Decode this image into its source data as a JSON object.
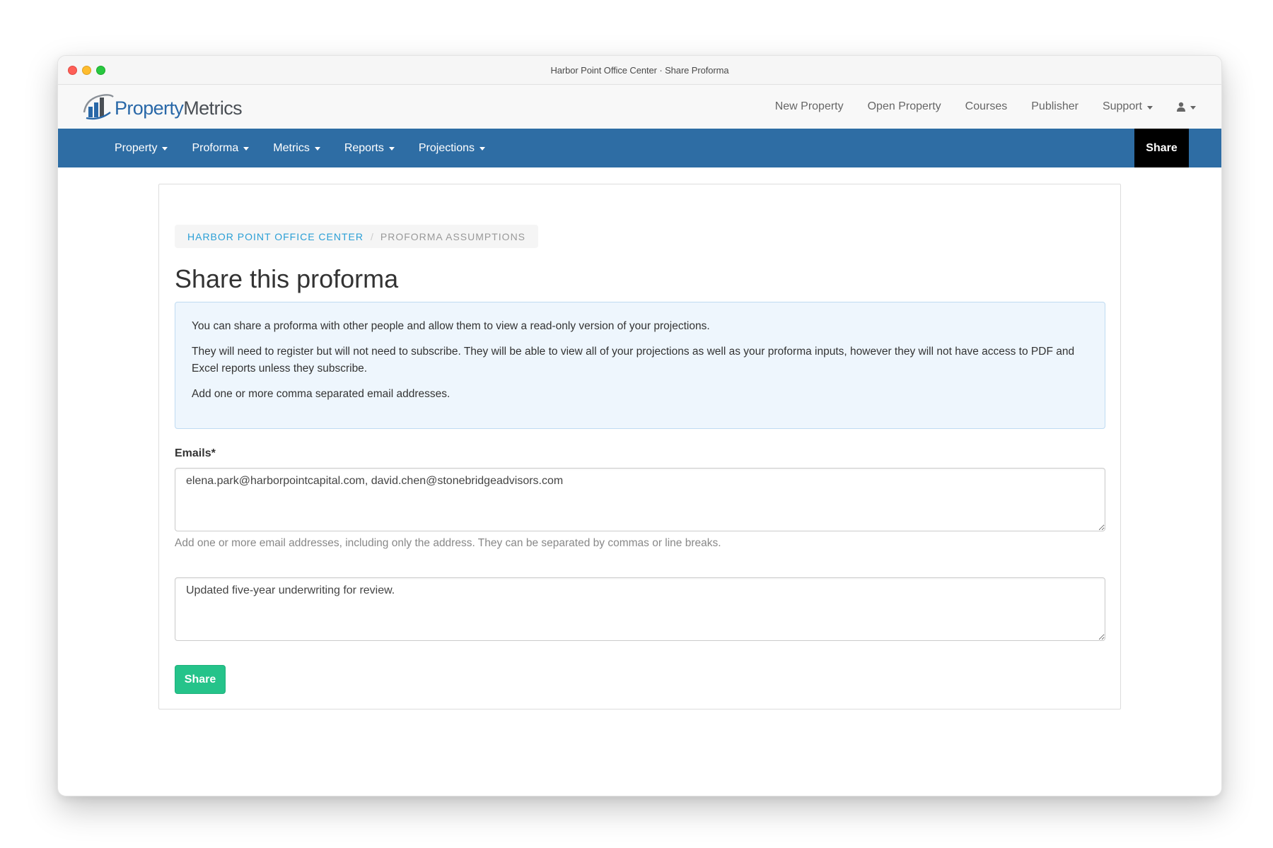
{
  "window": {
    "title": "Harbor Point Office Center · Share Proforma"
  },
  "brand": {
    "name_part1": "Property",
    "name_part2": "Metrics",
    "primary_color": "#2e6da4",
    "logo_blue": "#2968a8",
    "logo_gray": "#4a4f55"
  },
  "topnav": {
    "links": [
      {
        "label": "New Property"
      },
      {
        "label": "Open Property"
      },
      {
        "label": "Courses"
      },
      {
        "label": "Publisher"
      },
      {
        "label": "Support",
        "dropdown": true
      }
    ],
    "user_menu": {
      "icon": "user-icon",
      "dropdown": true
    }
  },
  "subnav": {
    "items": [
      {
        "label": "Property"
      },
      {
        "label": "Proforma"
      },
      {
        "label": "Metrics"
      },
      {
        "label": "Reports"
      },
      {
        "label": "Projections"
      }
    ],
    "active_label": "Share",
    "active_bg": "#000000"
  },
  "breadcrumb": {
    "items": [
      "HARBOR POINT OFFICE CENTER",
      "PROFORMA ASSUMPTIONS"
    ],
    "separator": "/"
  },
  "page": {
    "title": "Share this proforma"
  },
  "info": {
    "p1": "You can share a proforma with other people and allow them to view a read-only version of your projections.",
    "p2": "They will need to register but will not need to subscribe. They will be able to view all of your projections as well as your proforma inputs, however they will not have access to PDF and Excel reports unless they subscribe.",
    "p3": "Add one or more comma separated email addresses."
  },
  "form": {
    "emails_label": "Emails*",
    "emails_value": "elena.park@harborpointcapital.com, david.chen@stonebridgeadvisors.com",
    "emails_help": "Add one or more email addresses, including only the address. They can be separated by commas or line breaks.",
    "message_value": "Updated five-year underwriting for review.",
    "submit_label": "Share",
    "submit_color": "#25c38a"
  }
}
